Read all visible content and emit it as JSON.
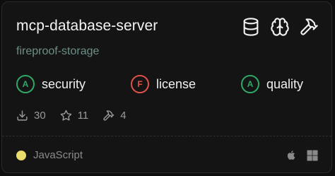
{
  "card": {
    "title": "mcp-database-server",
    "subtitle": "fireproof-storage",
    "header_icons": [
      "database-icon",
      "brain-icon",
      "hammer-icon"
    ],
    "badges": [
      {
        "grade": "A",
        "label": "security",
        "status": "pass",
        "color": "#2fa866"
      },
      {
        "grade": "F",
        "label": "license",
        "status": "fail",
        "color": "#e0504a"
      },
      {
        "grade": "A",
        "label": "quality",
        "status": "pass",
        "color": "#2fa866"
      }
    ],
    "stats": {
      "downloads": "30",
      "stars": "11",
      "tools": "4"
    },
    "language": {
      "name": "JavaScript",
      "color": "#e8dc6a"
    },
    "platform_icons": [
      "apple-icon",
      "windows-icon"
    ]
  }
}
